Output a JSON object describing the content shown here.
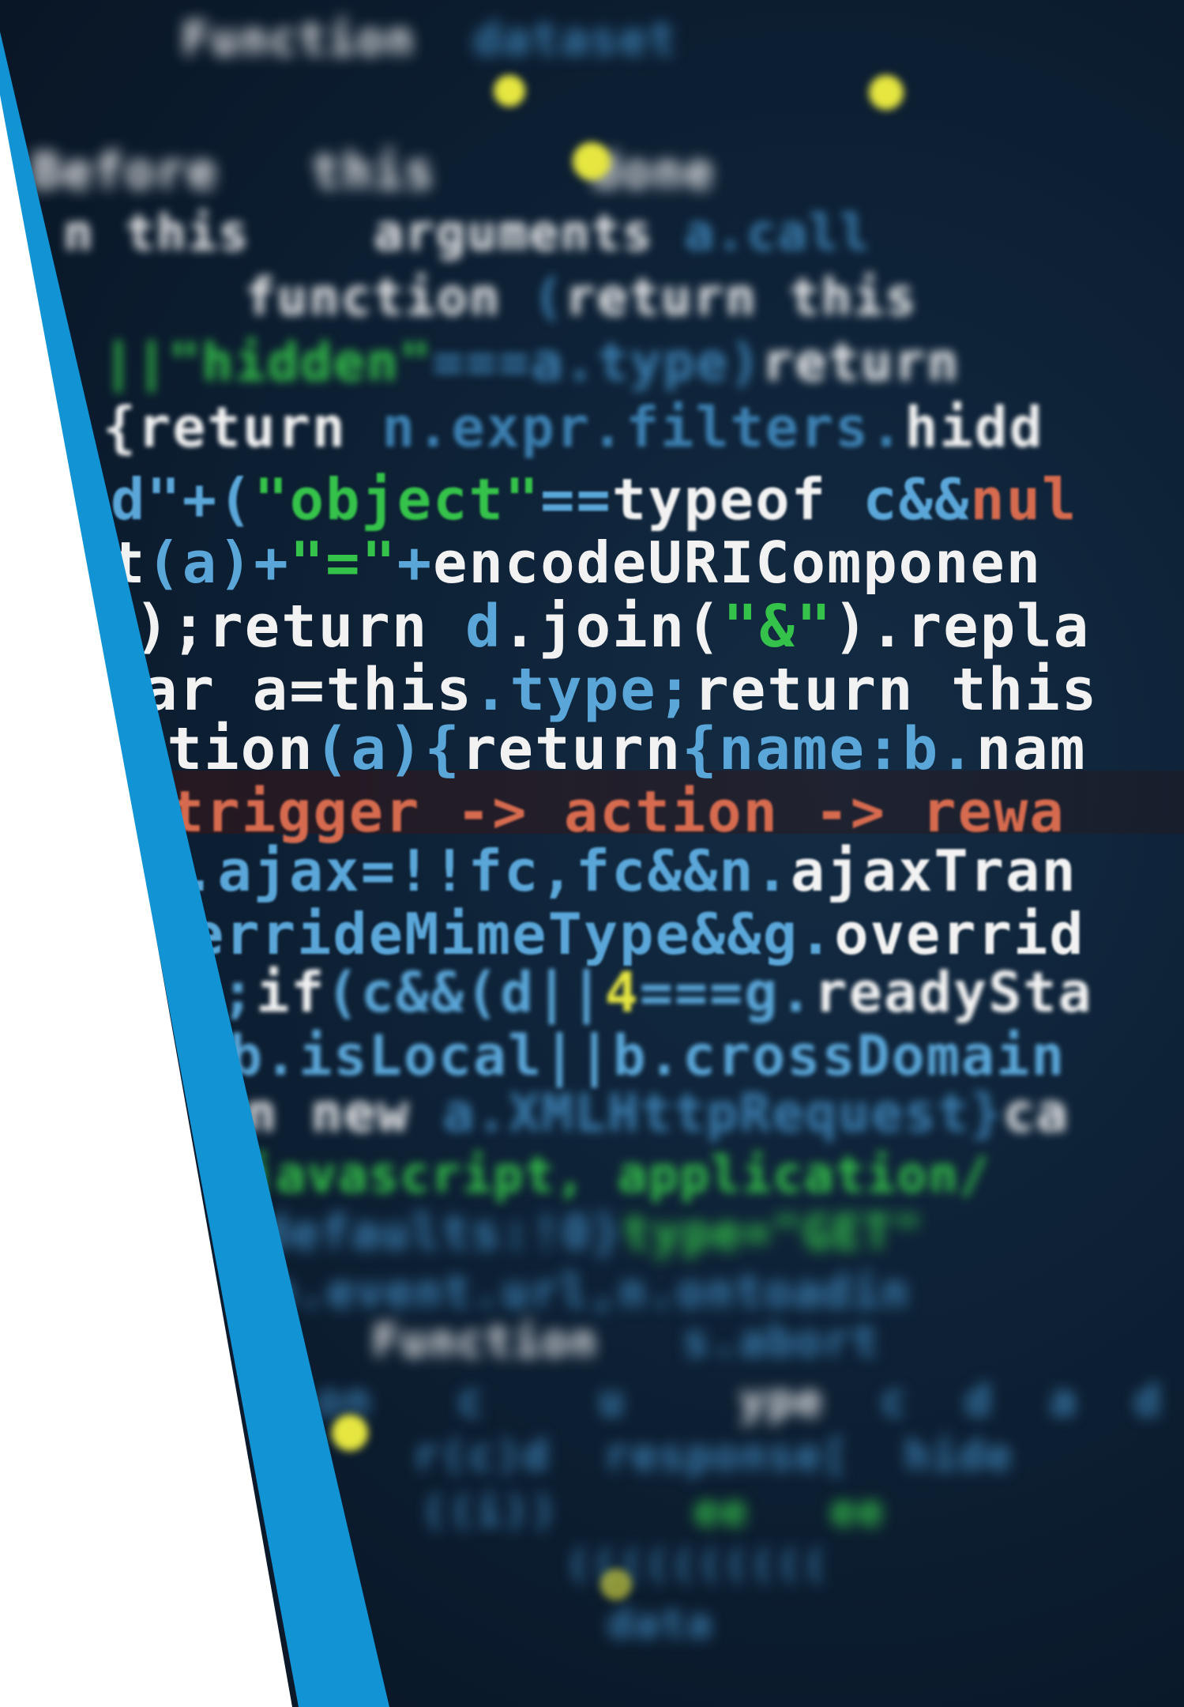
{
  "colors": {
    "accent_blue": "#1293d4",
    "code_white": "#f2f2f2",
    "code_cyan": "#5aa6d8",
    "code_green": "#35c24a",
    "code_red": "#d56a4e",
    "code_yellow": "#e6e640",
    "code_dim_blue": "#3c7fb0"
  },
  "code": {
    "lines": [
      {
        "segments": [
          {
            "text": "Function",
            "color": "code_white"
          },
          {
            "text": "  dataset  ",
            "color": "code_dim_blue"
          }
        ]
      },
      {
        "segments": [
          {
            "text": "",
            "color": "code_dim_blue"
          }
        ]
      },
      {
        "segments": [
          {
            "text": "Before   this  ",
            "color": "code_white"
          },
          {
            "text": " ",
            "color": "code_dim_blue"
          },
          {
            "text": "  done  ",
            "color": "code_white"
          }
        ]
      },
      {
        "segments": [
          {
            "text": "n this    arguments",
            "color": "code_white"
          },
          {
            "text": " a.call ",
            "color": "code_dim_blue"
          }
        ]
      },
      {
        "segments": [
          {
            "text": "function",
            "color": "code_white"
          },
          {
            "text": " (",
            "color": "code_dim_blue"
          },
          {
            "text": "return this",
            "color": "code_white"
          }
        ]
      },
      {
        "segments": [
          {
            "text": "||\"hidden\"",
            "color": "code_green"
          },
          {
            "text": "===a.type)",
            "color": "code_dim_blue"
          },
          {
            "text": "return",
            "color": "code_white"
          }
        ]
      },
      {
        "segments": [
          {
            "text": "{return",
            "color": "code_white"
          },
          {
            "text": " n.expr.filters.",
            "color": "code_dim_blue"
          },
          {
            "text": "hidd",
            "color": "code_white"
          }
        ]
      },
      {
        "segments": [
          {
            "text": "d\"+(",
            "color": "code_cyan"
          },
          {
            "text": "\"object\"",
            "color": "code_green"
          },
          {
            "text": "==",
            "color": "code_cyan"
          },
          {
            "text": "typeof",
            "color": "code_white"
          },
          {
            "text": " c&&",
            "color": "code_cyan"
          },
          {
            "text": "nul",
            "color": "code_red"
          }
        ]
      },
      {
        "segments": [
          {
            "text": "t",
            "color": "code_white"
          },
          {
            "text": "(a)+",
            "color": "code_cyan"
          },
          {
            "text": "\"=\"",
            "color": "code_green"
          },
          {
            "text": "+",
            "color": "code_cyan"
          },
          {
            "text": "encodeURIComponen",
            "color": "code_white"
          }
        ]
      },
      {
        "segments": [
          {
            "text": ");return ",
            "color": "code_white"
          },
          {
            "text": "d",
            "color": "code_cyan"
          },
          {
            "text": ".join(",
            "color": "code_white"
          },
          {
            "text": "\"&\"",
            "color": "code_green"
          },
          {
            "text": ").repla",
            "color": "code_white"
          }
        ]
      },
      {
        "segments": [
          {
            "text": "ar a=this",
            "color": "code_white"
          },
          {
            "text": ".type;",
            "color": "code_cyan"
          },
          {
            "text": "return this",
            "color": "code_white"
          }
        ]
      },
      {
        "segments": [
          {
            "text": "ction",
            "color": "code_white"
          },
          {
            "text": "(a){",
            "color": "code_cyan"
          },
          {
            "text": "return",
            "color": "code_white"
          },
          {
            "text": "{name:b.",
            "color": "code_cyan"
          },
          {
            "text": "nam",
            "color": "code_white"
          }
        ]
      },
      {
        "segments": [
          {
            "text": "trigger -> action -> rewa",
            "color": "code_red"
          }
        ]
      },
      {
        "segments": [
          {
            "text": ".ajax=!!fc,fc&&n.",
            "color": "code_cyan"
          },
          {
            "text": "ajaxTran",
            "color": "code_white"
          }
        ]
      },
      {
        "segments": [
          {
            "text": "errideMimeType&&g.",
            "color": "code_cyan"
          },
          {
            "text": "overrid",
            "color": "code_white"
          }
        ]
      },
      {
        "segments": [
          {
            "text": ";",
            "color": "code_cyan"
          },
          {
            "text": "if",
            "color": "code_white"
          },
          {
            "text": "(c&&(d||",
            "color": "code_cyan"
          },
          {
            "text": "4",
            "color": "code_yellow"
          },
          {
            "text": "===g.",
            "color": "code_cyan"
          },
          {
            "text": "readySta",
            "color": "code_white"
          }
        ]
      },
      {
        "segments": [
          {
            "text": "b.isLocal||b.crossDomain",
            "color": "code_cyan"
          }
        ]
      },
      {
        "segments": [
          {
            "text": "n new ",
            "color": "code_white"
          },
          {
            "text": "a.XMLHttpRequest}",
            "color": "code_dim_blue"
          },
          {
            "text": "ca",
            "color": "code_white"
          }
        ]
      },
      {
        "segments": [
          {
            "text": "javascript, application/",
            "color": "code_green"
          }
        ]
      },
      {
        "segments": [
          {
            "text": "defaults:!0}",
            "color": "code_dim_blue"
          },
          {
            "text": "type=\"GET\"",
            "color": "code_green"
          }
        ]
      },
      {
        "segments": [
          {
            "text": "n.event.url,n.ontoadin",
            "color": "code_dim_blue"
          }
        ]
      },
      {
        "segments": [
          {
            "text": "  Function  ",
            "color": "code_white"
          },
          {
            "text": " s.abort  ",
            "color": "code_dim_blue"
          }
        ]
      },
      {
        "segments": [
          {
            "text": "on   c    u    ",
            "color": "code_dim_blue"
          },
          {
            "text": "ype",
            "color": "code_white"
          },
          {
            "text": "  c  d  a  d",
            "color": "code_dim_blue"
          }
        ]
      },
      {
        "segments": [
          {
            "text": "   r(c)d  response[  hide  ",
            "color": "code_dim_blue"
          }
        ]
      },
      {
        "segments": [
          {
            "text": "   ((i))  ",
            "color": "code_dim_blue"
          },
          {
            "text": "   ee   ee ",
            "color": "code_green"
          }
        ]
      },
      {
        "segments": [
          {
            "text": "        ((((((((((  ",
            "color": "code_dim_blue"
          }
        ]
      },
      {
        "segments": [
          {
            "text": "         data    ",
            "color": "code_dim_blue"
          }
        ]
      }
    ]
  }
}
